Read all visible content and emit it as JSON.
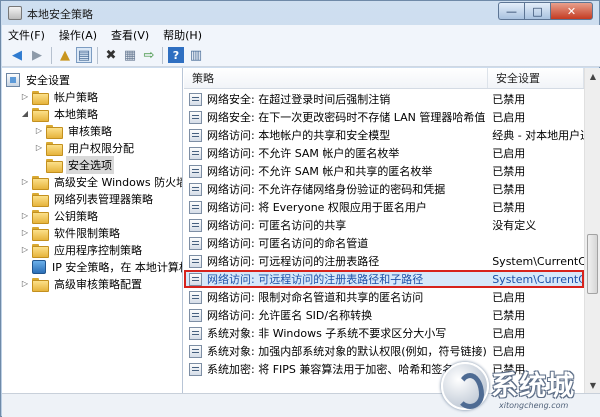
{
  "window": {
    "title": "本地安全策略",
    "minimize": "—",
    "maximize": "□",
    "close": "✕"
  },
  "menubar": {
    "items": [
      "文件(F)",
      "操作(A)",
      "查看(V)",
      "帮助(H)"
    ]
  },
  "toolbar": {
    "icons": [
      "back-arrow-icon",
      "forward-arrow-icon",
      "up-folder-icon",
      "show-tree-icon",
      "delete-icon",
      "properties-icon",
      "export-list-icon",
      "help-icon",
      "show-hide-pane-icon"
    ],
    "glyphs": {
      "back": "◀",
      "forward": "▶",
      "up": "▲",
      "tree": "▤",
      "delete": "✖",
      "properties": "▦",
      "export": "⇨",
      "help": "?",
      "pane": "▥"
    }
  },
  "tree": {
    "items": [
      {
        "label": "安全设置",
        "expanded": true
      },
      {
        "label": "帐户策略",
        "expanded": false
      },
      {
        "label": "本地策略",
        "expanded": true
      },
      {
        "label": "审核策略",
        "expanded": false
      },
      {
        "label": "用户权限分配",
        "expanded": false
      },
      {
        "label": "安全选项",
        "selected": true
      },
      {
        "label": "高级安全 Windows 防火墙",
        "expanded": false
      },
      {
        "label": "网络列表管理器策略"
      },
      {
        "label": "公钥策略",
        "expanded": false
      },
      {
        "label": "软件限制策略",
        "expanded": false
      },
      {
        "label": "应用程序控制策略",
        "expanded": false
      },
      {
        "label": "IP 安全策略，在 本地计算机"
      },
      {
        "label": "高级审核策略配置",
        "expanded": false
      }
    ],
    "arrow_expanded": "◢",
    "arrow_collapsed": "▷"
  },
  "list": {
    "columns": {
      "policy": "策略",
      "setting": "安全设置"
    },
    "rows": [
      {
        "policy": "网络安全: 在超过登录时间后强制注销",
        "setting": "已禁用"
      },
      {
        "policy": "网络安全: 在下一次更改密码时不存储 LAN 管理器哈希值",
        "setting": "已启用"
      },
      {
        "policy": "网络访问: 本地帐户的共享和安全模型",
        "setting": "经典 - 对本地用户进"
      },
      {
        "policy": "网络访问: 不允许 SAM 帐户的匿名枚举",
        "setting": "已启用"
      },
      {
        "policy": "网络访问: 不允许 SAM 帐户和共享的匿名枚举",
        "setting": "已禁用"
      },
      {
        "policy": "网络访问: 不允许存储网络身份验证的密码和凭据",
        "setting": "已禁用"
      },
      {
        "policy": "网络访问: 将 Everyone 权限应用于匿名用户",
        "setting": "已禁用"
      },
      {
        "policy": "网络访问: 可匿名访问的共享",
        "setting": "没有定义"
      },
      {
        "policy": "网络访问: 可匿名访问的命名管道",
        "setting": ""
      },
      {
        "policy": "网络访问: 可远程访问的注册表路径",
        "setting": "System\\CurrentCo"
      },
      {
        "policy": "网络访问: 可远程访问的注册表路径和子路径",
        "setting": "System\\CurrentCo",
        "highlight": true
      },
      {
        "policy": "网络访问: 限制对命名管道和共享的匿名访问",
        "setting": "已启用"
      },
      {
        "policy": "网络访问: 允许匿名 SID/名称转换",
        "setting": "已禁用"
      },
      {
        "policy": "系统对象: 非 Windows 子系统不要求区分大小写",
        "setting": "已启用"
      },
      {
        "policy": "系统对象: 加强内部系统对象的默认权限(例如，符号链接)",
        "setting": "已启用"
      },
      {
        "policy": "系统加密: 将 FIPS 兼容算法用于加密、哈希和签名",
        "setting": "已禁用"
      }
    ]
  },
  "scrollbar": {
    "up": "▲",
    "down": "▼"
  },
  "watermark": {
    "title": "系统城",
    "url": "xitongcheng.com"
  }
}
